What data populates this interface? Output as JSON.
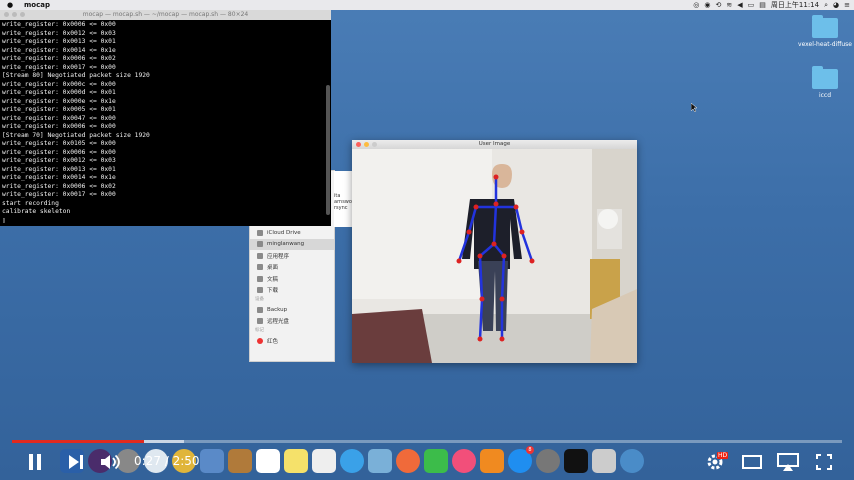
{
  "menubar": {
    "app_name": "mocap",
    "clock": "周日上午11:14"
  },
  "desktop_icons": [
    {
      "label": "vexel-heat-diffuse"
    },
    {
      "label": "iccd"
    }
  ],
  "terminal": {
    "title": "mocap — mocap.sh — ~/mocap — mocap.sh — 80×24",
    "lines": [
      "write_register: 0x0006 <= 0x00",
      "write_register: 0x0012 <= 0x03",
      "write_register: 0x0013 <= 0x01",
      "write_register: 0x0014 <= 0x1e",
      "write_register: 0x0006 <= 0x02",
      "write_register: 0x0017 <= 0x00",
      "[Stream 80] Negotiated packet size 1920",
      "write_register: 0x000c <= 0x00",
      "write_register: 0x000d <= 0x01",
      "write_register: 0x000e <= 0x1e",
      "write_register: 0x0005 <= 0x01",
      "write_register: 0x0047 <= 0x00",
      "write_register: 0x0006 <= 0x00",
      "[Stream 70] Negotiated packet size 1920",
      "write_register: 0x0105 <= 0x00",
      "write_register: 0x0006 <= 0x00",
      "write_register: 0x0012 <= 0x03",
      "write_register: 0x0013 <= 0x01",
      "write_register: 0x0014 <= 0x1e",
      "write_register: 0x0006 <= 0x02",
      "write_register: 0x0017 <= 0x00",
      "start recording",
      "calibrate skeleton",
      "▯"
    ]
  },
  "finder": {
    "column_items": [
      "ita",
      "arnswo",
      "rsync"
    ],
    "items": [
      {
        "label": "iCloud Drive",
        "selected": false
      },
      {
        "label": "minglanwang",
        "selected": true
      },
      {
        "label": "应用程序",
        "selected": false
      },
      {
        "label": "桌面",
        "selected": false
      },
      {
        "label": "文稿",
        "selected": false
      },
      {
        "label": "下载",
        "selected": false
      }
    ],
    "devices_header": "设备",
    "devices": [
      {
        "label": "Backup"
      },
      {
        "label": "远程光盘"
      }
    ],
    "tags_header": "标记",
    "tags": [
      {
        "label": "红色"
      }
    ]
  },
  "user_image_window": {
    "title": "User Image"
  },
  "player": {
    "current_time": "0:27",
    "duration": "2:50",
    "time_display": "0:27 / 2:50",
    "progress_fraction": 0.159,
    "hd_badge": "HD"
  },
  "dock": {
    "notification_badge": "8"
  },
  "colors": {
    "progress_played": "#e22a1e",
    "skeleton_bone": "#2233dd",
    "skeleton_joint": "#dd2222"
  }
}
